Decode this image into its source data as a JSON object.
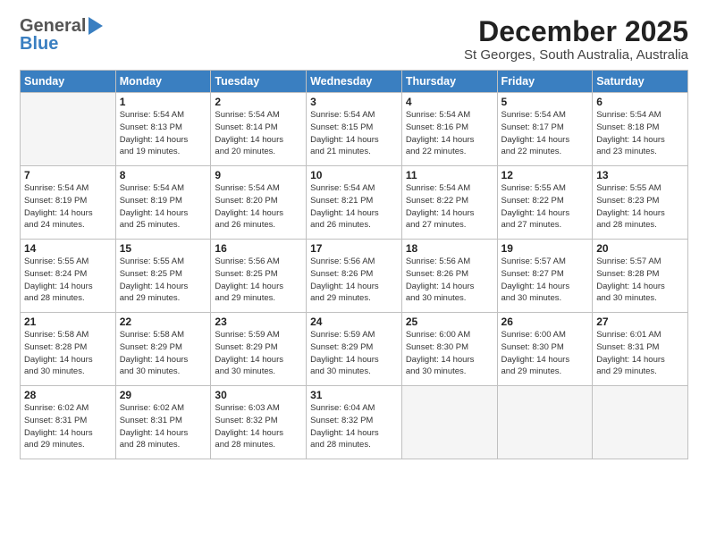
{
  "header": {
    "logo_general": "General",
    "logo_blue": "Blue",
    "month_title": "December 2025",
    "location": "St Georges, South Australia, Australia"
  },
  "weekdays": [
    "Sunday",
    "Monday",
    "Tuesday",
    "Wednesday",
    "Thursday",
    "Friday",
    "Saturday"
  ],
  "weeks": [
    [
      {
        "day": "",
        "info": ""
      },
      {
        "day": "1",
        "info": "Sunrise: 5:54 AM\nSunset: 8:13 PM\nDaylight: 14 hours\nand 19 minutes."
      },
      {
        "day": "2",
        "info": "Sunrise: 5:54 AM\nSunset: 8:14 PM\nDaylight: 14 hours\nand 20 minutes."
      },
      {
        "day": "3",
        "info": "Sunrise: 5:54 AM\nSunset: 8:15 PM\nDaylight: 14 hours\nand 21 minutes."
      },
      {
        "day": "4",
        "info": "Sunrise: 5:54 AM\nSunset: 8:16 PM\nDaylight: 14 hours\nand 22 minutes."
      },
      {
        "day": "5",
        "info": "Sunrise: 5:54 AM\nSunset: 8:17 PM\nDaylight: 14 hours\nand 22 minutes."
      },
      {
        "day": "6",
        "info": "Sunrise: 5:54 AM\nSunset: 8:18 PM\nDaylight: 14 hours\nand 23 minutes."
      }
    ],
    [
      {
        "day": "7",
        "info": "Sunrise: 5:54 AM\nSunset: 8:19 PM\nDaylight: 14 hours\nand 24 minutes."
      },
      {
        "day": "8",
        "info": "Sunrise: 5:54 AM\nSunset: 8:19 PM\nDaylight: 14 hours\nand 25 minutes."
      },
      {
        "day": "9",
        "info": "Sunrise: 5:54 AM\nSunset: 8:20 PM\nDaylight: 14 hours\nand 26 minutes."
      },
      {
        "day": "10",
        "info": "Sunrise: 5:54 AM\nSunset: 8:21 PM\nDaylight: 14 hours\nand 26 minutes."
      },
      {
        "day": "11",
        "info": "Sunrise: 5:54 AM\nSunset: 8:22 PM\nDaylight: 14 hours\nand 27 minutes."
      },
      {
        "day": "12",
        "info": "Sunrise: 5:55 AM\nSunset: 8:22 PM\nDaylight: 14 hours\nand 27 minutes."
      },
      {
        "day": "13",
        "info": "Sunrise: 5:55 AM\nSunset: 8:23 PM\nDaylight: 14 hours\nand 28 minutes."
      }
    ],
    [
      {
        "day": "14",
        "info": "Sunrise: 5:55 AM\nSunset: 8:24 PM\nDaylight: 14 hours\nand 28 minutes."
      },
      {
        "day": "15",
        "info": "Sunrise: 5:55 AM\nSunset: 8:25 PM\nDaylight: 14 hours\nand 29 minutes."
      },
      {
        "day": "16",
        "info": "Sunrise: 5:56 AM\nSunset: 8:25 PM\nDaylight: 14 hours\nand 29 minutes."
      },
      {
        "day": "17",
        "info": "Sunrise: 5:56 AM\nSunset: 8:26 PM\nDaylight: 14 hours\nand 29 minutes."
      },
      {
        "day": "18",
        "info": "Sunrise: 5:56 AM\nSunset: 8:26 PM\nDaylight: 14 hours\nand 30 minutes."
      },
      {
        "day": "19",
        "info": "Sunrise: 5:57 AM\nSunset: 8:27 PM\nDaylight: 14 hours\nand 30 minutes."
      },
      {
        "day": "20",
        "info": "Sunrise: 5:57 AM\nSunset: 8:28 PM\nDaylight: 14 hours\nand 30 minutes."
      }
    ],
    [
      {
        "day": "21",
        "info": "Sunrise: 5:58 AM\nSunset: 8:28 PM\nDaylight: 14 hours\nand 30 minutes."
      },
      {
        "day": "22",
        "info": "Sunrise: 5:58 AM\nSunset: 8:29 PM\nDaylight: 14 hours\nand 30 minutes."
      },
      {
        "day": "23",
        "info": "Sunrise: 5:59 AM\nSunset: 8:29 PM\nDaylight: 14 hours\nand 30 minutes."
      },
      {
        "day": "24",
        "info": "Sunrise: 5:59 AM\nSunset: 8:29 PM\nDaylight: 14 hours\nand 30 minutes."
      },
      {
        "day": "25",
        "info": "Sunrise: 6:00 AM\nSunset: 8:30 PM\nDaylight: 14 hours\nand 30 minutes."
      },
      {
        "day": "26",
        "info": "Sunrise: 6:00 AM\nSunset: 8:30 PM\nDaylight: 14 hours\nand 29 minutes."
      },
      {
        "day": "27",
        "info": "Sunrise: 6:01 AM\nSunset: 8:31 PM\nDaylight: 14 hours\nand 29 minutes."
      }
    ],
    [
      {
        "day": "28",
        "info": "Sunrise: 6:02 AM\nSunset: 8:31 PM\nDaylight: 14 hours\nand 29 minutes."
      },
      {
        "day": "29",
        "info": "Sunrise: 6:02 AM\nSunset: 8:31 PM\nDaylight: 14 hours\nand 28 minutes."
      },
      {
        "day": "30",
        "info": "Sunrise: 6:03 AM\nSunset: 8:32 PM\nDaylight: 14 hours\nand 28 minutes."
      },
      {
        "day": "31",
        "info": "Sunrise: 6:04 AM\nSunset: 8:32 PM\nDaylight: 14 hours\nand 28 minutes."
      },
      {
        "day": "",
        "info": ""
      },
      {
        "day": "",
        "info": ""
      },
      {
        "day": "",
        "info": ""
      }
    ]
  ]
}
